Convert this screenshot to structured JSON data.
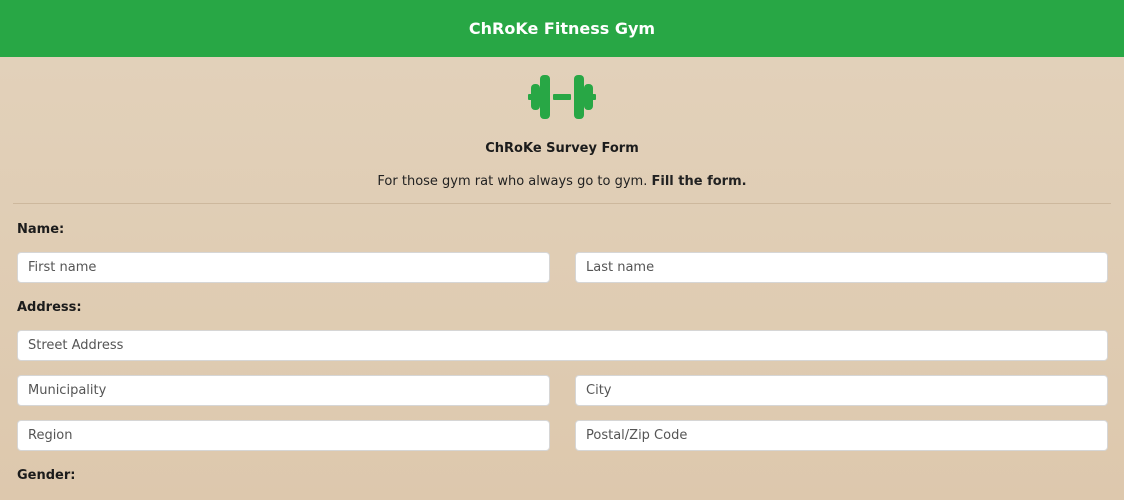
{
  "header": {
    "title": "ChRoKe Fitness Gym"
  },
  "logo": {
    "icon": "dumbbell-icon",
    "color": "#28a745"
  },
  "form": {
    "title": "ChRoKe Survey Form",
    "subtitle_plain": "For those gym rat who always go to gym.",
    "subtitle_bold": "Fill the form.",
    "name_label": "Name:",
    "first_name_placeholder": "First name",
    "last_name_placeholder": "Last name",
    "address_label": "Address:",
    "street_placeholder": "Street Address",
    "municipality_placeholder": "Municipality",
    "city_placeholder": "City",
    "region_placeholder": "Region",
    "postal_placeholder": "Postal/Zip Code",
    "gender_label": "Gender:"
  },
  "colors": {
    "accent": "#28a745",
    "background": "#decab0"
  }
}
